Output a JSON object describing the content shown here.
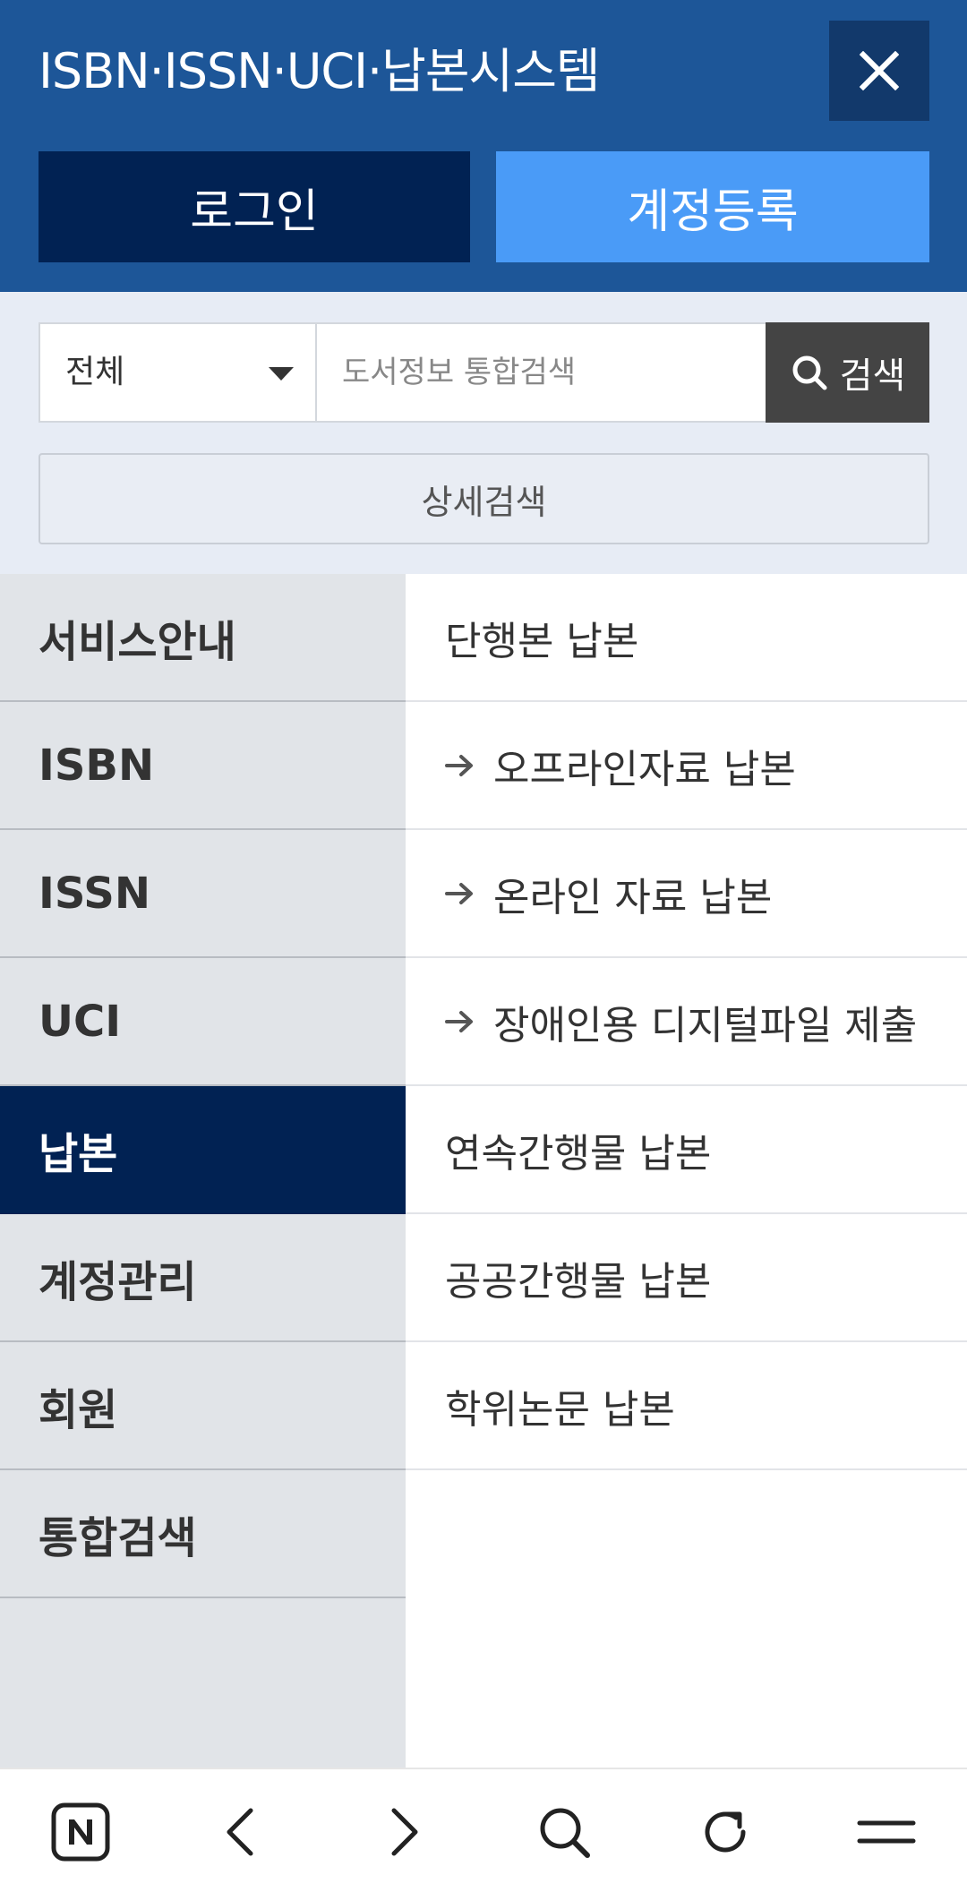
{
  "header": {
    "title": "ISBN·ISSN·UCI·납본시스템",
    "login_label": "로그인",
    "register_label": "계정등록",
    "close_icon": "close-icon"
  },
  "search": {
    "scope_value": "전체",
    "placeholder": "도서정보 통합검색",
    "button_label": "검색",
    "advanced_label": "상세검색"
  },
  "menu": {
    "left": [
      {
        "label": "서비스안내"
      },
      {
        "label": "ISBN"
      },
      {
        "label": "ISSN"
      },
      {
        "label": "UCI"
      },
      {
        "label": "납본",
        "active": true
      },
      {
        "label": "계정관리"
      },
      {
        "label": "회원"
      },
      {
        "label": "통합검색"
      }
    ],
    "right": [
      {
        "label": "단행본 납본"
      },
      {
        "label": "오프라인자료 납본",
        "sub": true
      },
      {
        "label": "온라인 자료 납본",
        "sub": true
      },
      {
        "label": "장애인용 디지털파일 제출",
        "sub": true
      },
      {
        "label": "연속간행물 납본"
      },
      {
        "label": "공공간행물 납본"
      },
      {
        "label": "학위논문 납본"
      }
    ]
  },
  "browser_nav": [
    "naver-home-icon",
    "back-icon",
    "forward-icon",
    "search-icon",
    "refresh-icon",
    "menu-icon"
  ],
  "colors": {
    "header_bg": "#1d5698",
    "login_bg": "#012253",
    "register_bg": "#4a9bf7",
    "search_btn_bg": "#444444",
    "search_area_bg": "#e7ecf5",
    "active_menu_bg": "#012253",
    "left_menu_bg": "#e1e4e8"
  }
}
